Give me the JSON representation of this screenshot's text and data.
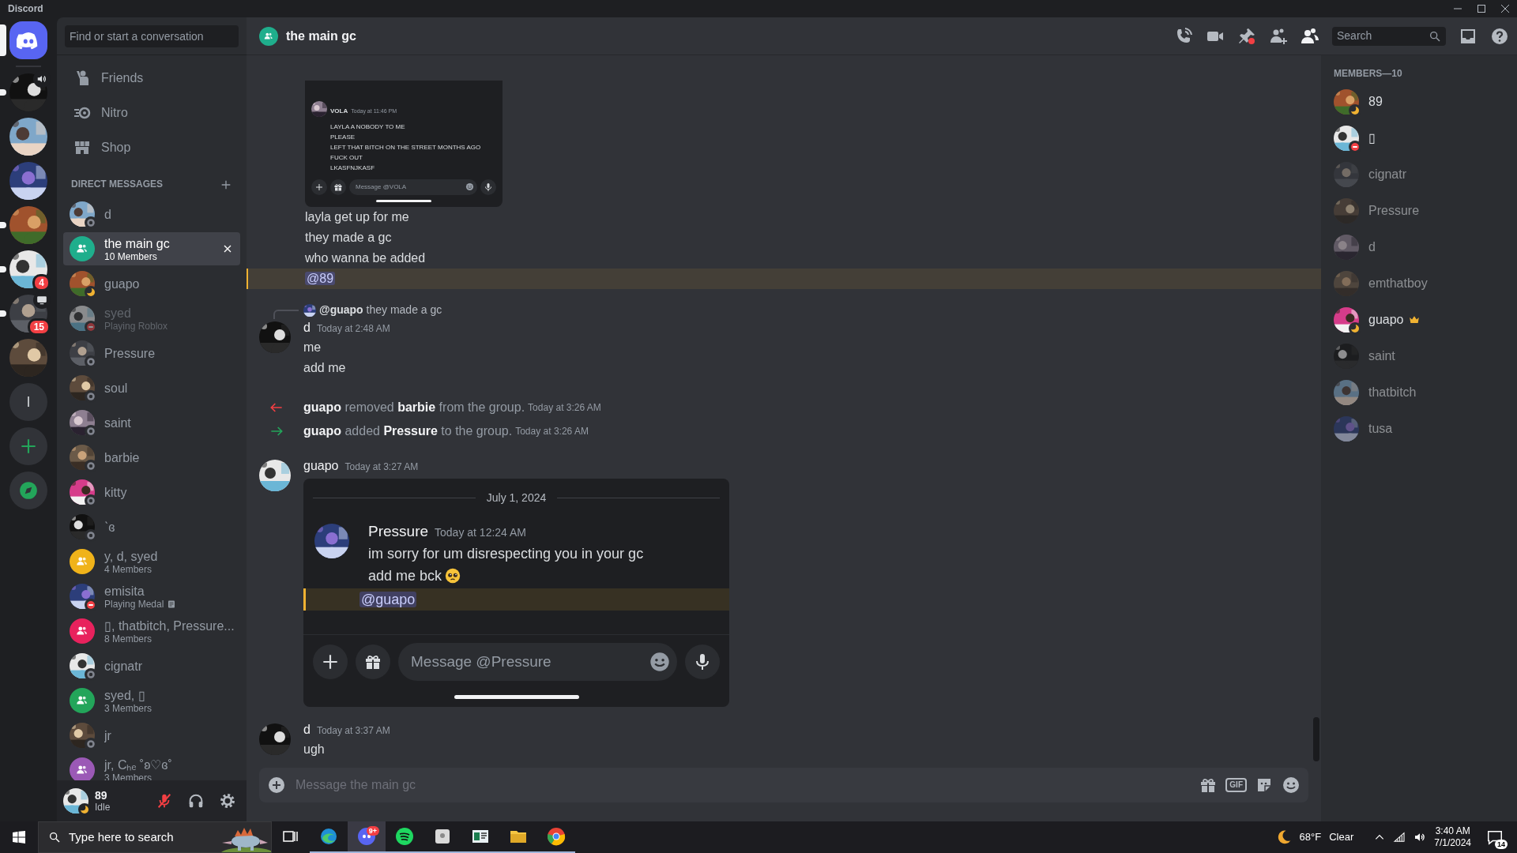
{
  "window": {
    "title": "Discord"
  },
  "servers": [
    {
      "kind": "home",
      "selected": true
    },
    {
      "kind": "picture",
      "selected": false,
      "unread": true,
      "in_voice": true
    },
    {
      "kind": "picture",
      "selected": false,
      "unread": false,
      "in_voice": false,
      "streaming": false
    },
    {
      "kind": "picture",
      "selected": false,
      "unread": false,
      "in_voice": false,
      "streaming": false
    },
    {
      "kind": "picture",
      "selected": false,
      "unread": true,
      "in_voice": false,
      "streaming": false
    },
    {
      "kind": "picture",
      "selected": false,
      "unread": true,
      "in_voice": false,
      "streaming": false,
      "mentions": "4"
    },
    {
      "kind": "picture",
      "selected": false,
      "unread": true,
      "in_voice": false,
      "streaming": true,
      "mentions": "15"
    },
    {
      "kind": "picture",
      "selected": false,
      "unread": false,
      "in_voice": false,
      "streaming": false
    },
    {
      "kind": "letter",
      "label": "l",
      "selected": false,
      "unread": false
    },
    {
      "kind": "add"
    },
    {
      "kind": "discover"
    }
  ],
  "sidebar": {
    "search_placeholder": "Find or start a conversation",
    "nav": [
      {
        "kind": "friends",
        "label": "Friends",
        "selected": false
      },
      {
        "kind": "nitro",
        "label": "Nitro",
        "selected": false
      },
      {
        "kind": "shop",
        "label": "Shop",
        "selected": false
      }
    ],
    "section_title": "DIRECT MESSAGES",
    "dms": [
      {
        "kind": "user",
        "name": "d",
        "idle": false,
        "dnd": false,
        "selected": false,
        "faded": false
      },
      {
        "kind": "group",
        "name": "the main gc",
        "subtitle": "10 Members",
        "color": "#1fae8c",
        "selected": true,
        "faded": false,
        "rich_presence": false
      },
      {
        "kind": "user",
        "name": "guapo",
        "idle": true,
        "dnd": false,
        "selected": false,
        "faded": false
      },
      {
        "kind": "user",
        "name": "syed",
        "subtitle": "Playing Roblox",
        "dnd": true,
        "selected": false,
        "faded": true,
        "rich_presence": false
      },
      {
        "kind": "user",
        "name": "Pressure",
        "idle": false,
        "dnd": false,
        "selected": false,
        "faded": false
      },
      {
        "kind": "user",
        "name": "soul",
        "idle": false,
        "dnd": false,
        "selected": false,
        "faded": false
      },
      {
        "kind": "user",
        "name": "saint",
        "idle": false,
        "dnd": false,
        "selected": false,
        "faded": false
      },
      {
        "kind": "user",
        "name": "barbie",
        "idle": false,
        "dnd": false,
        "selected": false,
        "faded": false
      },
      {
        "kind": "user",
        "name": "kitty",
        "idle": false,
        "dnd": false,
        "selected": false,
        "faded": false
      },
      {
        "kind": "user",
        "name": "ˋɞ",
        "idle": false,
        "dnd": false,
        "selected": false,
        "faded": false
      },
      {
        "kind": "group",
        "name": "y, d, syed",
        "subtitle": "4 Members",
        "color": "#f0b31a",
        "selected": false,
        "faded": false,
        "rich_presence": false
      },
      {
        "kind": "user",
        "name": "emisita",
        "subtitle": "Playing Medal",
        "dnd": true,
        "selected": false,
        "faded": false,
        "rich_presence": true
      },
      {
        "kind": "group",
        "name": "▯, thatbitch, Pressure...",
        "subtitle": "8 Members",
        "color": "#e8225d",
        "selected": false,
        "faded": false,
        "rich_presence": false
      },
      {
        "kind": "user",
        "name": "cignatr",
        "idle": false,
        "dnd": false,
        "selected": false,
        "faded": false
      },
      {
        "kind": "group",
        "name": "syed, ▯",
        "subtitle": "3 Members",
        "color": "#23a55a",
        "selected": false,
        "faded": false,
        "rich_presence": false
      },
      {
        "kind": "user",
        "name": "jr",
        "idle": false,
        "dnd": false,
        "selected": false,
        "faded": false
      },
      {
        "kind": "group",
        "name": "jr, Cₕₑ ˚ʚ♡ɞ˚",
        "subtitle": "3 Members",
        "color": "#9b59b6",
        "selected": false,
        "faded": false,
        "rich_presence": false
      }
    ]
  },
  "user_panel": {
    "name": "89",
    "status_text": "Idle",
    "idle": true,
    "dnd": false,
    "mic_muted": true
  },
  "channel": {
    "title": "the main gc",
    "search_placeholder": "Search"
  },
  "messages": [
    {
      "kind": "screenshot_small",
      "author": "VOLA",
      "time": "Today at 11:46 PM",
      "lines": [
        "LAYLA A NOBODY TO ME",
        "PLEASE",
        "LEFT THAT BITCH ON THE STREET MONTHS AGO",
        "FUCK OUT",
        "LKASFNJKASF"
      ],
      "composer": "Message @VOLA"
    },
    {
      "kind": "line",
      "text": "layla get up for me",
      "mention": false,
      "highlighted": false
    },
    {
      "kind": "line",
      "text": "they made a gc",
      "mention": false,
      "highlighted": false
    },
    {
      "kind": "line",
      "text": "who wanna be added",
      "mention": false,
      "highlighted": false
    },
    {
      "kind": "line",
      "text": "@89",
      "mention": true,
      "highlighted": true
    },
    {
      "kind": "reply",
      "reply_text": "**@guapo** they made a gc",
      "author": "d",
      "time": "Today at 2:48 AM",
      "lines": [
        "me",
        "add me"
      ]
    },
    {
      "kind": "member_removed",
      "text": "**guapo** removed **barbie** from the group.",
      "time": "Today at 3:26 AM"
    },
    {
      "kind": "member_added",
      "text": "**guapo** added **Pressure** to the group.",
      "time": "Today at 3:26 AM"
    },
    {
      "kind": "screenshot",
      "author": "guapo",
      "time": "Today at 3:27 AM",
      "date": "July 1, 2024",
      "shot_author": "Pressure",
      "shot_time": "Today at 12:24 AM",
      "lines": [
        "im sorry for um disrespecting you in your gc",
        "add me bck"
      ],
      "mention": "@guapo",
      "composer": "Message @Pressure"
    },
    {
      "kind": "message",
      "author": "d",
      "time": "Today at 3:37 AM",
      "lines": [
        "ugh"
      ]
    }
  ],
  "composer": {
    "placeholder": "Message the main gc",
    "gif_label": "GIF"
  },
  "members": {
    "title": "MEMBERS—10",
    "items": [
      {
        "name": "89",
        "idle": true,
        "dnd": false,
        "faded": false,
        "owner": false
      },
      {
        "name": "▯",
        "dnd": true,
        "faded": false,
        "owner": false
      },
      {
        "name": "cignatr",
        "faded": true,
        "owner": false
      },
      {
        "name": "Pressure",
        "faded": true,
        "owner": false
      },
      {
        "name": "d",
        "faded": true,
        "owner": false
      },
      {
        "name": "emthatboy",
        "faded": true,
        "owner": false
      },
      {
        "name": "guapo",
        "idle": true,
        "dnd": false,
        "faded": false,
        "owner": true
      },
      {
        "name": "saint",
        "faded": true,
        "owner": false
      },
      {
        "name": "thatbitch",
        "faded": true,
        "owner": false
      },
      {
        "name": "tusa",
        "faded": true,
        "owner": false
      }
    ]
  },
  "taskbar": {
    "search_placeholder": "Type here to search",
    "discord_badge": "9+",
    "temperature": "68°F",
    "weather": "Clear",
    "time": "3:40 AM",
    "date": "7/1/2024",
    "notifications": "14"
  }
}
